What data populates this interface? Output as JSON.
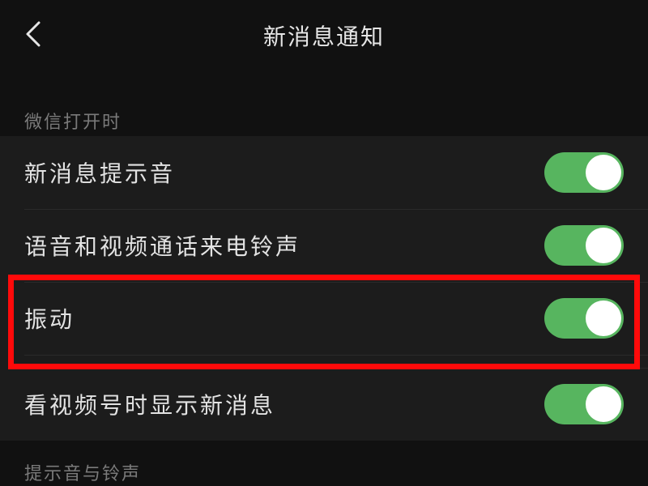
{
  "header": {
    "title": "新消息通知",
    "back_icon": "chevron-left-icon"
  },
  "sections": [
    {
      "label": "微信打开时",
      "items": [
        {
          "label": "新消息提示音",
          "enabled": true
        },
        {
          "label": "语音和视频通话来电铃声",
          "enabled": true
        },
        {
          "label": "振动",
          "enabled": true,
          "highlighted": true
        },
        {
          "label": "看视频号时显示新消息",
          "enabled": true
        }
      ]
    },
    {
      "label": "提示音与铃声",
      "items": []
    }
  ],
  "colors": {
    "background": "#111111",
    "row_background": "#1c1c1c",
    "toggle_on": "#57b55f",
    "highlight_border": "#ff0a0a",
    "section_label": "#7a7a7a"
  }
}
